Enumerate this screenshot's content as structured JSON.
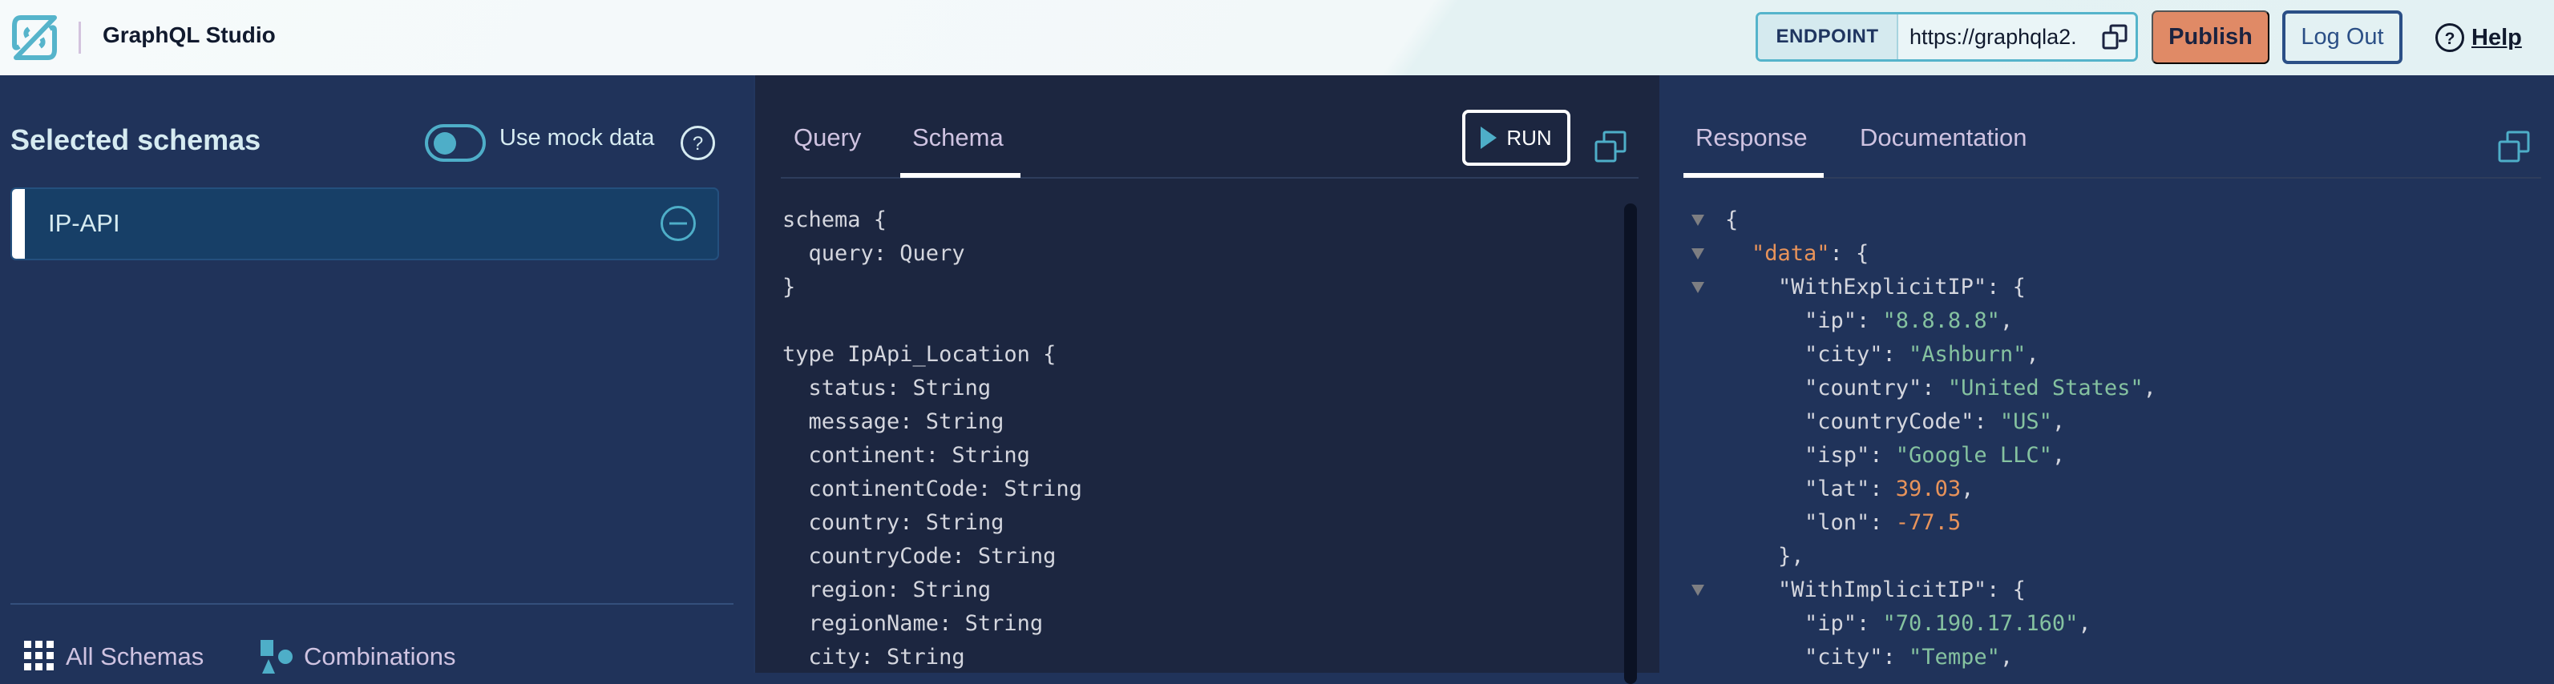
{
  "header": {
    "app_title": "GraphQL Studio",
    "logo_icon": "studio-logo-icon",
    "endpoint_label": "ENDPOINT",
    "endpoint_url": "https://graphqla2.",
    "copy_icon": "copy-icon",
    "publish_label": "Publish",
    "logout_label": "Log Out",
    "help_label": "Help",
    "help_icon": "question-circle-icon"
  },
  "left_panel": {
    "title": "Selected schemas",
    "mock_toggle": {
      "label": "Use mock data",
      "enabled": false
    },
    "help_icon": "question-circle-icon",
    "schemas": [
      {
        "name": "IP-API",
        "remove_icon": "minus-circle-icon"
      }
    ],
    "nav": [
      {
        "label": "All Schemas",
        "icon": "grid-icon"
      },
      {
        "label": "Combinations",
        "icon": "shapes-icon"
      }
    ]
  },
  "editor_panel": {
    "tabs": [
      {
        "label": "Query",
        "active": false
      },
      {
        "label": "Schema",
        "active": true
      }
    ],
    "run_label": "RUN",
    "expand_icon": "copy-icon",
    "code_lines": [
      "schema {",
      "  query: Query",
      "}",
      "",
      "type IpApi_Location {",
      "  status: String",
      "  message: String",
      "  continent: String",
      "  continentCode: String",
      "  country: String",
      "  countryCode: String",
      "  region: String",
      "  regionName: String",
      "  city: String"
    ]
  },
  "response_panel": {
    "tabs": [
      {
        "label": "Response",
        "active": true
      },
      {
        "label": "Documentation",
        "active": false
      }
    ],
    "expand_icon": "copy-icon",
    "json_lines": [
      {
        "indent": 0,
        "collapsible": true,
        "parts": [
          {
            "t": "{",
            "c": "p"
          }
        ]
      },
      {
        "indent": 1,
        "collapsible": true,
        "parts": [
          {
            "t": "\"data\"",
            "c": "ko"
          },
          {
            "t": ": {",
            "c": "p"
          }
        ]
      },
      {
        "indent": 2,
        "collapsible": true,
        "parts": [
          {
            "t": "\"WithExplicitIP\": {",
            "c": "p"
          }
        ]
      },
      {
        "indent": 3,
        "collapsible": false,
        "parts": [
          {
            "t": "\"ip\": ",
            "c": "p"
          },
          {
            "t": "\"8.8.8.8\"",
            "c": "s"
          },
          {
            "t": ",",
            "c": "p"
          }
        ]
      },
      {
        "indent": 3,
        "collapsible": false,
        "parts": [
          {
            "t": "\"city\": ",
            "c": "p"
          },
          {
            "t": "\"Ashburn\"",
            "c": "s"
          },
          {
            "t": ",",
            "c": "p"
          }
        ]
      },
      {
        "indent": 3,
        "collapsible": false,
        "parts": [
          {
            "t": "\"country\": ",
            "c": "p"
          },
          {
            "t": "\"United States\"",
            "c": "s"
          },
          {
            "t": ",",
            "c": "p"
          }
        ]
      },
      {
        "indent": 3,
        "collapsible": false,
        "parts": [
          {
            "t": "\"countryCode\": ",
            "c": "p"
          },
          {
            "t": "\"US\"",
            "c": "s"
          },
          {
            "t": ",",
            "c": "p"
          }
        ]
      },
      {
        "indent": 3,
        "collapsible": false,
        "parts": [
          {
            "t": "\"isp\": ",
            "c": "p"
          },
          {
            "t": "\"Google LLC\"",
            "c": "s"
          },
          {
            "t": ",",
            "c": "p"
          }
        ]
      },
      {
        "indent": 3,
        "collapsible": false,
        "parts": [
          {
            "t": "\"lat\": ",
            "c": "p"
          },
          {
            "t": "39.03",
            "c": "n"
          },
          {
            "t": ",",
            "c": "p"
          }
        ]
      },
      {
        "indent": 3,
        "collapsible": false,
        "parts": [
          {
            "t": "\"lon\": ",
            "c": "p"
          },
          {
            "t": "-77.5",
            "c": "n"
          }
        ]
      },
      {
        "indent": 2,
        "collapsible": false,
        "parts": [
          {
            "t": "},",
            "c": "p"
          }
        ]
      },
      {
        "indent": 2,
        "collapsible": true,
        "parts": [
          {
            "t": "\"WithImplicitIP\": {",
            "c": "p"
          }
        ]
      },
      {
        "indent": 3,
        "collapsible": false,
        "parts": [
          {
            "t": "\"ip\": ",
            "c": "p"
          },
          {
            "t": "\"70.190.17.160\"",
            "c": "s"
          },
          {
            "t": ",",
            "c": "p"
          }
        ]
      },
      {
        "indent": 3,
        "collapsible": false,
        "parts": [
          {
            "t": "\"city\": ",
            "c": "p"
          },
          {
            "t": "\"Tempe\"",
            "c": "s"
          },
          {
            "t": ",",
            "c": "p"
          }
        ]
      }
    ]
  },
  "colors": {
    "accent_teal": "#4eaec8",
    "publish_orange": "#e08a66",
    "logout_blue": "#2b4f86",
    "panel_navy": "#20335a",
    "editor_bg": "#1c2640",
    "json_key_orange": "#e8935a",
    "json_string_green": "#85c2a0"
  }
}
